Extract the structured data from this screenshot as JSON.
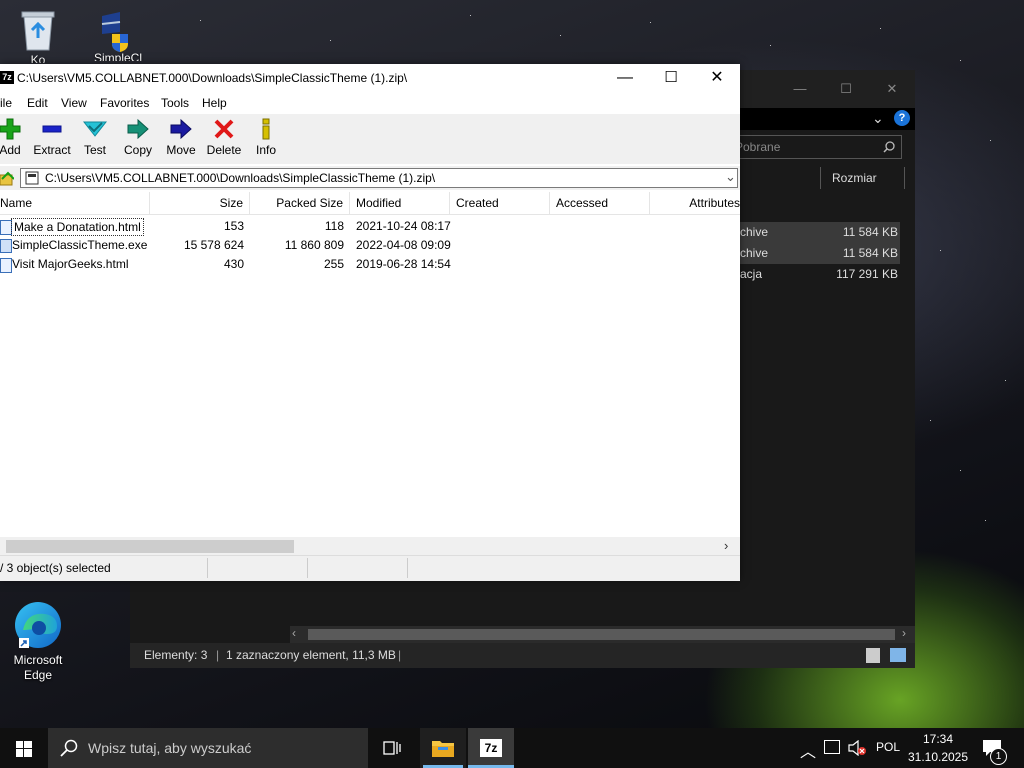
{
  "desktop": {
    "icons": [
      {
        "name": "recycle-bin",
        "label": "Ko"
      },
      {
        "name": "simple-classic",
        "label": "SimpleCl"
      },
      {
        "name": "edge",
        "label": "Microsoft Edge"
      }
    ]
  },
  "explorer": {
    "search_placeholder": "Pobrane",
    "column_header": "Rozmiar",
    "rows": [
      {
        "type": "chive",
        "size": "11 584 KB"
      },
      {
        "type": "chive",
        "size": "11 584 KB"
      },
      {
        "type": "acja",
        "size": "117 291 KB"
      }
    ],
    "status": {
      "elements": "Elementy: 3",
      "selected": "1 zaznaczony element, 11,3 MB"
    }
  },
  "zip": {
    "title": "C:\\Users\\VM5.COLLABNET.000\\Downloads\\SimpleClassicTheme (1).zip\\",
    "menu": [
      "ile",
      "Edit",
      "View",
      "Favorites",
      "Tools",
      "Help"
    ],
    "toolbar": [
      {
        "label": "Add",
        "icon": "plus-icon",
        "color": "#16a316"
      },
      {
        "label": "Extract",
        "icon": "minus-icon",
        "color": "#1a23c8"
      },
      {
        "label": "Test",
        "icon": "check-icon",
        "color": "#17b4c8"
      },
      {
        "label": "Copy",
        "icon": "copy-arrow-icon",
        "color": "#138a6e"
      },
      {
        "label": "Move",
        "icon": "move-arrow-icon",
        "color": "#1a1a9e"
      },
      {
        "label": "Delete",
        "icon": "delete-x-icon",
        "color": "#e01818"
      },
      {
        "label": "Info",
        "icon": "info-icon",
        "color": "#c8b400"
      }
    ],
    "address": "C:\\Users\\VM5.COLLABNET.000\\Downloads\\SimpleClassicTheme (1).zip\\",
    "columns": [
      "Name",
      "Size",
      "Packed Size",
      "Modified",
      "Created",
      "Accessed",
      "Attributes"
    ],
    "files": [
      {
        "name": "Make a Donatation.html",
        "size": "153",
        "packed": "118",
        "modified": "2021-10-24 08:17",
        "icon": "html-file-icon"
      },
      {
        "name": "SimpleClassicTheme.exe",
        "size": "15 578 624",
        "packed": "11 860 809",
        "modified": "2022-04-08 09:09",
        "icon": "exe-file-icon"
      },
      {
        "name": "Visit MajorGeeks.html",
        "size": "430",
        "packed": "255",
        "modified": "2019-06-28 14:54",
        "icon": "html-file-icon"
      }
    ],
    "status": "/ 3 object(s) selected"
  },
  "taskbar": {
    "search_placeholder": "Wpisz tutaj, aby wyszukać",
    "language": "POL",
    "time": "17:34",
    "date": "31.10.2025",
    "notification_count": "1"
  }
}
